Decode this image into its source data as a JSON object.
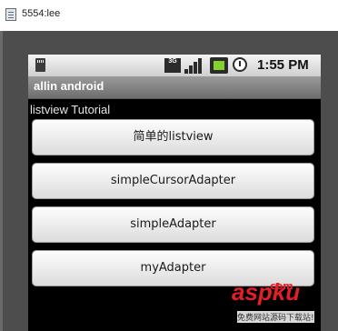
{
  "window": {
    "title": "5554:lee"
  },
  "status_bar": {
    "network_label": "3G",
    "time": "1:55 PM"
  },
  "app": {
    "title": "allin android",
    "heading": "listview Tutorial",
    "buttons": [
      {
        "label": "简单的listview"
      },
      {
        "label": "simpleCursorAdapter"
      },
      {
        "label": "simpleAdapter"
      },
      {
        "label": "myAdapter"
      }
    ]
  },
  "watermark": {
    "logo": "aspku",
    "sub": ".com",
    "caption": "免费网站源码下载站!"
  },
  "icons": {
    "sd_card": "sd-card-icon",
    "signal": "signal-icon",
    "battery": "battery-charging-icon",
    "alarm": "alarm-clock-icon"
  }
}
